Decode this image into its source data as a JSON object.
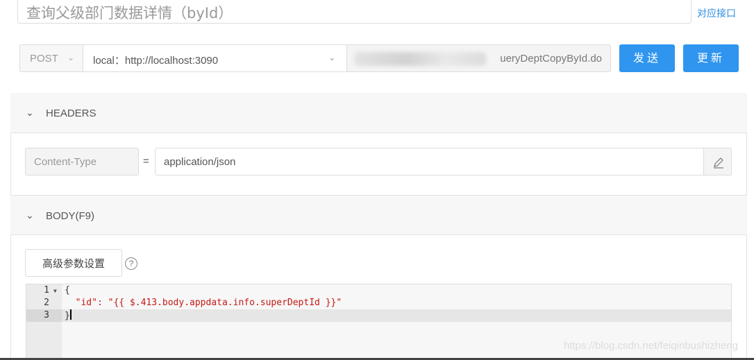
{
  "title_input": {
    "value": "查询父级部门数据详情（byId）"
  },
  "corresponding_link": "对应接口",
  "request": {
    "method": "POST",
    "environment": "local：http://localhost:3090",
    "url_visible": "ueryDeptCopyById.do",
    "send_label": "发送",
    "update_label": "更新"
  },
  "headers_section": {
    "title": "HEADERS",
    "rows": [
      {
        "key": "Content-Type",
        "value": "application/json"
      }
    ]
  },
  "body_section": {
    "title": "BODY(F9)",
    "advanced_button": "高级参数设置",
    "help_icon": "question-circle-icon",
    "editor": {
      "line_numbers": [
        "1",
        "2",
        "3"
      ],
      "lines": [
        "{",
        "  \"id\": ",
        "\"{{ $.413.body.appdata.info.superDeptId }}\"",
        "}"
      ]
    }
  },
  "watermark": "https://blog.csdn.net/feiqinbushizheng",
  "colors": {
    "primary": "#2f95ef",
    "link": "#2f8de4",
    "string": "#c41a16"
  }
}
